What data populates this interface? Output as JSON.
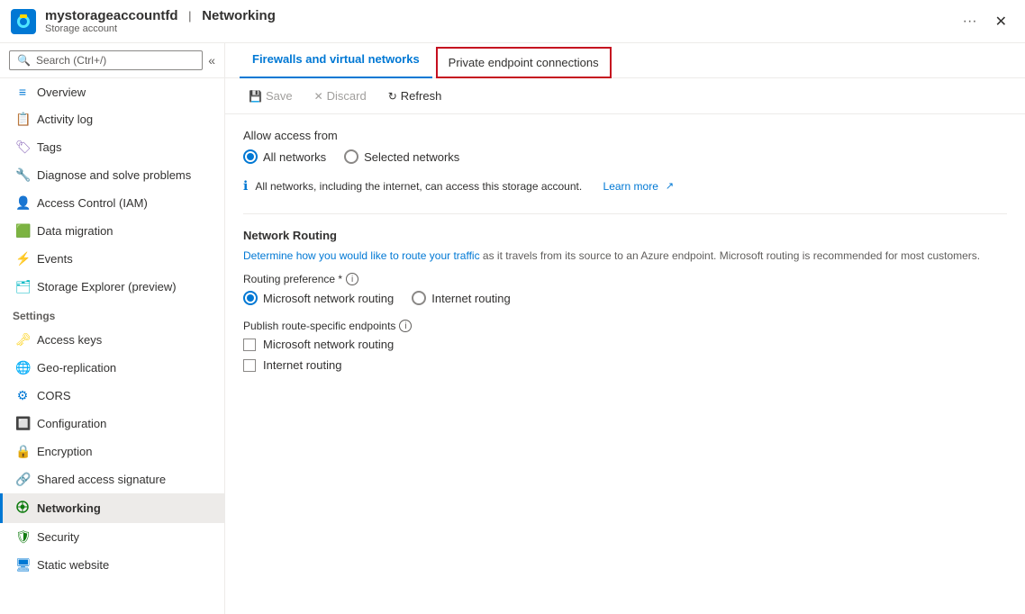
{
  "titleBar": {
    "name": "mystorageaccountfd",
    "separator": "|",
    "section": "Networking",
    "subtitle": "Storage account",
    "ellipsis": "···",
    "closeLabel": "✕"
  },
  "sidebar": {
    "searchPlaceholder": "Search (Ctrl+/)",
    "collapseIcon": "«",
    "items": [
      {
        "id": "overview",
        "label": "Overview",
        "icon": "⬛",
        "iconColor": "icon-blue",
        "active": false
      },
      {
        "id": "activity-log",
        "label": "Activity log",
        "icon": "📋",
        "iconColor": "icon-blue",
        "active": false
      },
      {
        "id": "tags",
        "label": "Tags",
        "icon": "🏷",
        "iconColor": "icon-purple",
        "active": false
      },
      {
        "id": "diagnose",
        "label": "Diagnose and solve problems",
        "icon": "🔑",
        "iconColor": "icon-purple",
        "active": false
      },
      {
        "id": "access-control",
        "label": "Access Control (IAM)",
        "icon": "👤",
        "iconColor": "icon-blue",
        "active": false
      },
      {
        "id": "data-migration",
        "label": "Data migration",
        "icon": "🟩",
        "iconColor": "icon-green",
        "active": false
      },
      {
        "id": "events",
        "label": "Events",
        "icon": "⚡",
        "iconColor": "icon-yellow",
        "active": false
      },
      {
        "id": "storage-explorer",
        "label": "Storage Explorer (preview)",
        "icon": "🔲",
        "iconColor": "icon-teal",
        "active": false
      }
    ],
    "sectionLabel": "Settings",
    "settingsItems": [
      {
        "id": "access-keys",
        "label": "Access keys",
        "icon": "🗝",
        "iconColor": "icon-yellow",
        "active": false
      },
      {
        "id": "geo-replication",
        "label": "Geo-replication",
        "icon": "🌐",
        "iconColor": "icon-blue",
        "active": false
      },
      {
        "id": "cors",
        "label": "CORS",
        "icon": "⚙",
        "iconColor": "icon-blue",
        "active": false
      },
      {
        "id": "configuration",
        "label": "Configuration",
        "icon": "🔲",
        "iconColor": "icon-blue",
        "active": false
      },
      {
        "id": "encryption",
        "label": "Encryption",
        "icon": "🔒",
        "iconColor": "icon-blue",
        "active": false
      },
      {
        "id": "shared-access",
        "label": "Shared access signature",
        "icon": "🔗",
        "iconColor": "icon-blue",
        "active": false
      },
      {
        "id": "networking",
        "label": "Networking",
        "icon": "⚙",
        "iconColor": "icon-green",
        "active": true
      },
      {
        "id": "security",
        "label": "Security",
        "icon": "🛡",
        "iconColor": "icon-green",
        "active": false
      },
      {
        "id": "static-website",
        "label": "Static website",
        "icon": "🖥",
        "iconColor": "icon-blue",
        "active": false
      }
    ]
  },
  "tabs": [
    {
      "id": "firewalls",
      "label": "Firewalls and virtual networks",
      "active": true,
      "highlighted": false
    },
    {
      "id": "private-endpoint",
      "label": "Private endpoint connections",
      "active": false,
      "highlighted": true
    }
  ],
  "toolbar": {
    "saveLabel": "Save",
    "saveIcon": "💾",
    "discardLabel": "Discard",
    "discardIcon": "✕",
    "refreshLabel": "Refresh",
    "refreshIcon": "↻"
  },
  "content": {
    "allowAccessLabel": "Allow access from",
    "radioOptions": [
      {
        "id": "all-networks",
        "label": "All networks",
        "selected": true
      },
      {
        "id": "selected-networks",
        "label": "Selected networks",
        "selected": false
      }
    ],
    "infoBanner": {
      "text": "All networks, including the internet, can access this storage account.",
      "linkText": "Learn more",
      "linkIcon": "↗"
    },
    "networkRouting": {
      "title": "Network Routing",
      "description": "Determine how you would like to route your traffic as it travels from its source to an Azure endpoint. Microsoft routing is recommended for most customers.",
      "routingPreferenceLabel": "Routing preference *",
      "routingOptions": [
        {
          "id": "microsoft-routing",
          "label": "Microsoft network routing",
          "selected": true
        },
        {
          "id": "internet-routing",
          "label": "Internet routing",
          "selected": false
        }
      ],
      "publishEndpointsLabel": "Publish route-specific endpoints",
      "publishOptions": [
        {
          "id": "publish-microsoft",
          "label": "Microsoft network routing",
          "checked": false
        },
        {
          "id": "publish-internet",
          "label": "Internet routing",
          "checked": false
        }
      ]
    }
  }
}
